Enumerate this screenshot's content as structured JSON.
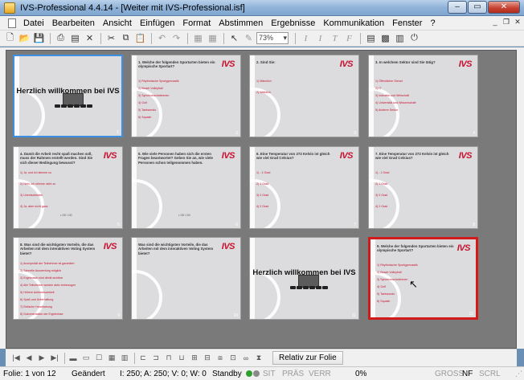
{
  "window": {
    "title": "IVS-Professional 4.4.14 - [Weiter mit IVS-Professional.isf]",
    "controls": {
      "minimize": "–",
      "maximize": "▭",
      "close": "✕"
    }
  },
  "menu": {
    "items": [
      "Datei",
      "Bearbeiten",
      "Ansicht",
      "Einfügen",
      "Format",
      "Abstimmen",
      "Ergebnisse",
      "Kommunikation",
      "Fenster",
      "?"
    ],
    "mdi": {
      "minimize": "_",
      "restore": "❐",
      "close": "✕"
    }
  },
  "toolbar": {
    "zoom": "73%",
    "icons": [
      "new-icon",
      "open-icon",
      "save-icon",
      "print-icon",
      "properties-icon",
      "delete-icon",
      "cut-icon",
      "copy-icon",
      "paste-icon",
      "undo-icon",
      "redo-icon",
      "slide-copy-icon",
      "slide-paste-icon",
      "pointer-icon",
      "pen-icon"
    ]
  },
  "slides": [
    {
      "kind": "welcome",
      "title": "Herzlich willkommen bei IVS",
      "number": "1",
      "selected": "blue"
    },
    {
      "kind": "question",
      "question": "1. Welche der folgenden Sportarten bieten ein olympische Sportart?",
      "answers": [
        "1) Rhythmische Sportgymnastik",
        "2) Beach Volleyball",
        "3) Synchronschwimmen",
        "4) Golf",
        "5) Taekwondo",
        "6) Squash"
      ],
      "number": "2",
      "logo": "IVS"
    },
    {
      "kind": "question",
      "question": "2. Sind Sie:",
      "answers": [
        "1) Männlich",
        "2) Weiblich"
      ],
      "number": "3",
      "logo": "IVS"
    },
    {
      "kind": "question",
      "question": "3. In welchem Sektor sind Sie tätig?",
      "answers": [
        "1) Öffentlicher Dienst",
        "2) IT",
        "3) Industrie und Wirtschaft",
        "4) Universität und Wissenschaft",
        "5) Anderer Sektor"
      ],
      "number": "4",
      "logo": "IVS"
    },
    {
      "kind": "question",
      "question": "4. Damit die Arbeit recht spaß machen soll, muss der Rahmen erstellt werden. Sind Sie sich dieser Bedingung bewusst?",
      "answers": [
        "1) Ja, und ich stimme zu",
        "2) Nein, ich stimme nicht zu",
        "3) Unentschieden",
        "4) Ja, aber nicht ganz"
      ],
      "number": "5",
      "logo": "IVS",
      "footer": "• 00 / 00"
    },
    {
      "kind": "question",
      "question": "5. Wie viele Personen haben sich die ersten Fragen beantwortet? Geben Sie an, wie viele Personen schon teilgenommen haben.",
      "answers": [],
      "number": "6",
      "logo": "IVS",
      "footer": "• 00 / 00"
    },
    {
      "kind": "question",
      "question": "6. Eine Temperatur von 272 Kelvin ist gleich wie viel Grad Celsius?",
      "answers": [
        "1) - 1 Grad",
        "2) 1 Grad",
        "3) 0 Grad",
        "4) 2 Grad"
      ],
      "number": "7",
      "logo": "IVS"
    },
    {
      "kind": "question",
      "question": "7. Eine Temperatur von 272 Kelvin ist gleich wie viel Grad Celsius?",
      "answers": [
        "1) - 1 Grad",
        "2) 1 Grad",
        "3) 0 Grad",
        "4) 2 Grad"
      ],
      "number": "8",
      "logo": "IVS"
    },
    {
      "kind": "question",
      "question": "8. Was sind die wichtigsten Vorteile, die das Arbeiten mit dem interaktiven Voting System bietet?",
      "answers": [
        "1) Anonymität der Teilnehmer ist garantiert",
        "2) Schnelle Auswertung möglich",
        "3) Ergebnisse sind direkt sichtbar",
        "4) Alle Teilnehmer werden aktiv einbezogen",
        "5) Höhere Aufmerksamkeit",
        "6) Spaß und Unterhaltung",
        "7) Einfache Handhabung",
        "8) Dokumentation der Ergebnisse"
      ],
      "number": "9",
      "logo": "IVS"
    },
    {
      "kind": "question",
      "question": "Was sind die wichtigsten Vorteile, die das Arbeiten mit dem interaktiven Voting System bietet?",
      "answers": [],
      "number": "10",
      "logo": "IVS"
    },
    {
      "kind": "welcome",
      "title": "Herzlich willkommen bei IVS",
      "number": "11"
    },
    {
      "kind": "question",
      "question": "9. Welche der folgenden Sportarten bieten ein olympische Sportart?",
      "answers": [
        "1) Rhythmische Sportgymnastik",
        "2) Beach Volleyball",
        "3) Synchronschwimmen",
        "4) Golf",
        "5) Taekwondo",
        "6) Squash"
      ],
      "number": "12",
      "logo": "IVS",
      "selected": "red"
    }
  ],
  "navbar": {
    "buttons": [
      "first-icon",
      "prev-icon",
      "next-icon",
      "last-icon"
    ],
    "relativ_label": "Relativ zur Folie"
  },
  "status": {
    "slide": "Folie: 1 von 12",
    "changed": "Geändert",
    "counts": "I: 250;  A: 250;  V: 0;  W: 0",
    "standby": "Standby",
    "sit": "SIT",
    "pras": "PRÄS",
    "verr": "VERR",
    "percent": "0%",
    "gross": "GROSS",
    "nf": "NF",
    "scrl": "SCRL"
  },
  "colors": {
    "accent_red": "#c8102e",
    "selection_blue": "#3d8fe3",
    "selection_red": "#d21a1a",
    "canvas": "#7a7a7a"
  }
}
